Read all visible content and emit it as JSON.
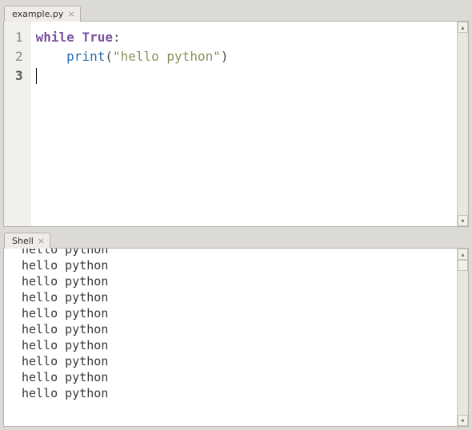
{
  "editor": {
    "tab_label": "example.py",
    "lines": [
      {
        "number": "1",
        "tokens": [
          {
            "t": "while ",
            "c": "tok-keyword"
          },
          {
            "t": "True",
            "c": "tok-keyword"
          },
          {
            "t": ":",
            "c": "tok-punc"
          }
        ]
      },
      {
        "number": "2",
        "tokens": [
          {
            "t": "    ",
            "c": ""
          },
          {
            "t": "print",
            "c": "tok-builtin"
          },
          {
            "t": "(",
            "c": "tok-punc"
          },
          {
            "t": "\"hello python\"",
            "c": "tok-string"
          },
          {
            "t": ")",
            "c": "tok-punc"
          }
        ]
      },
      {
        "number": "3",
        "tokens": []
      }
    ],
    "current_line_index": 2
  },
  "shell": {
    "tab_label": "Shell",
    "output_lines": [
      "hello python",
      "hello python",
      "hello python",
      "hello python",
      "hello python",
      "hello python",
      "hello python",
      "hello python",
      "hello python",
      "hello python"
    ]
  },
  "glyphs": {
    "tab_close": "×",
    "scroll_up": "▴",
    "scroll_down": "▾"
  }
}
